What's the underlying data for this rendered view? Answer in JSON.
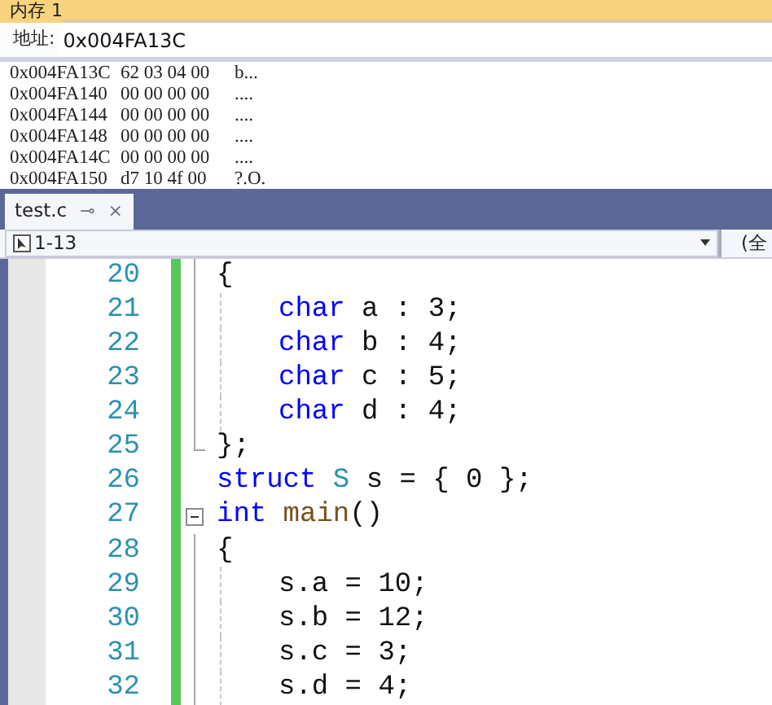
{
  "memory_window": {
    "title": "内存 1",
    "address_label": "地址:",
    "address": "0x004FA13C",
    "rows": [
      {
        "address": "0x004FA13C",
        "bytes": "62 03 04 00",
        "chars": "b..."
      },
      {
        "address": "0x004FA140",
        "bytes": "00 00 00 00",
        "chars": "...."
      },
      {
        "address": "0x004FA144",
        "bytes": "00 00 00 00",
        "chars": "...."
      },
      {
        "address": "0x004FA148",
        "bytes": "00 00 00 00",
        "chars": "...."
      },
      {
        "address": "0x004FA14C",
        "bytes": "00 00 00 00",
        "chars": "...."
      },
      {
        "address": "0x004FA150",
        "bytes": "d7 10 4f 00",
        "chars": "?.O."
      }
    ]
  },
  "tabs": [
    {
      "label": "test.c",
      "selected": true,
      "pin": "⊸",
      "close": "×"
    }
  ],
  "navigation_bar": {
    "scope": "1-13",
    "member": "(全"
  },
  "editor": {
    "lines": [
      {
        "number": "20",
        "kind": "outlined",
        "tokens": [
          {
            "text": "{",
            "kind": "plain"
          }
        ],
        "children": [
          {
            "number": "21",
            "kind": "outlined",
            "tokens": [
              {
                "text": "char",
                "kind": "keyword"
              },
              {
                "text": " a : 3;",
                "kind": "plain"
              }
            ]
          },
          {
            "number": "22",
            "kind": "outlined",
            "tokens": [
              {
                "text": "char",
                "kind": "keyword"
              },
              {
                "text": " b : 4;",
                "kind": "plain"
              }
            ]
          },
          {
            "number": "23",
            "kind": "outlined",
            "tokens": [
              {
                "text": "char",
                "kind": "keyword"
              },
              {
                "text": " c : 5;",
                "kind": "plain"
              }
            ]
          },
          {
            "number": "24",
            "kind": "outlined",
            "tokens": [
              {
                "text": "char",
                "kind": "keyword"
              },
              {
                "text": " d : 4;",
                "kind": "plain"
              }
            ]
          }
        ]
      },
      {
        "number": "25",
        "kind": "outline_end",
        "tokens": [
          {
            "text": "};",
            "kind": "plain"
          }
        ]
      },
      {
        "number": "26",
        "kind": "plain",
        "tokens": [
          {
            "text": "struct",
            "kind": "keyword"
          },
          {
            "text": " S",
            "kind": "type"
          },
          {
            "text": " s = { 0 };",
            "kind": "plain"
          }
        ]
      },
      {
        "number": "27",
        "kind": "fold_start",
        "tokens": [
          {
            "text": "int",
            "kind": "keyword"
          },
          {
            "text": " main",
            "kind": "function"
          },
          {
            "text": "()",
            "kind": "plain"
          }
        ]
      },
      {
        "number": "28",
        "kind": "outlined",
        "tokens": [
          {
            "text": "{",
            "kind": "plain"
          }
        ],
        "children": [
          {
            "number": "29",
            "kind": "outlined",
            "tokens": [
              {
                "text": "s.a = 10;",
                "kind": "plain"
              }
            ]
          },
          {
            "number": "30",
            "kind": "outlined",
            "tokens": [
              {
                "text": "s.b = 12;",
                "kind": "plain"
              }
            ]
          },
          {
            "number": "31",
            "kind": "outlined",
            "tokens": [
              {
                "text": "s.c = 3;",
                "kind": "plain"
              }
            ]
          },
          {
            "number": "32",
            "kind": "outlined",
            "tokens": [
              {
                "text": "s.d = 4;",
                "kind": "plain"
              }
            ]
          }
        ]
      }
    ]
  }
}
